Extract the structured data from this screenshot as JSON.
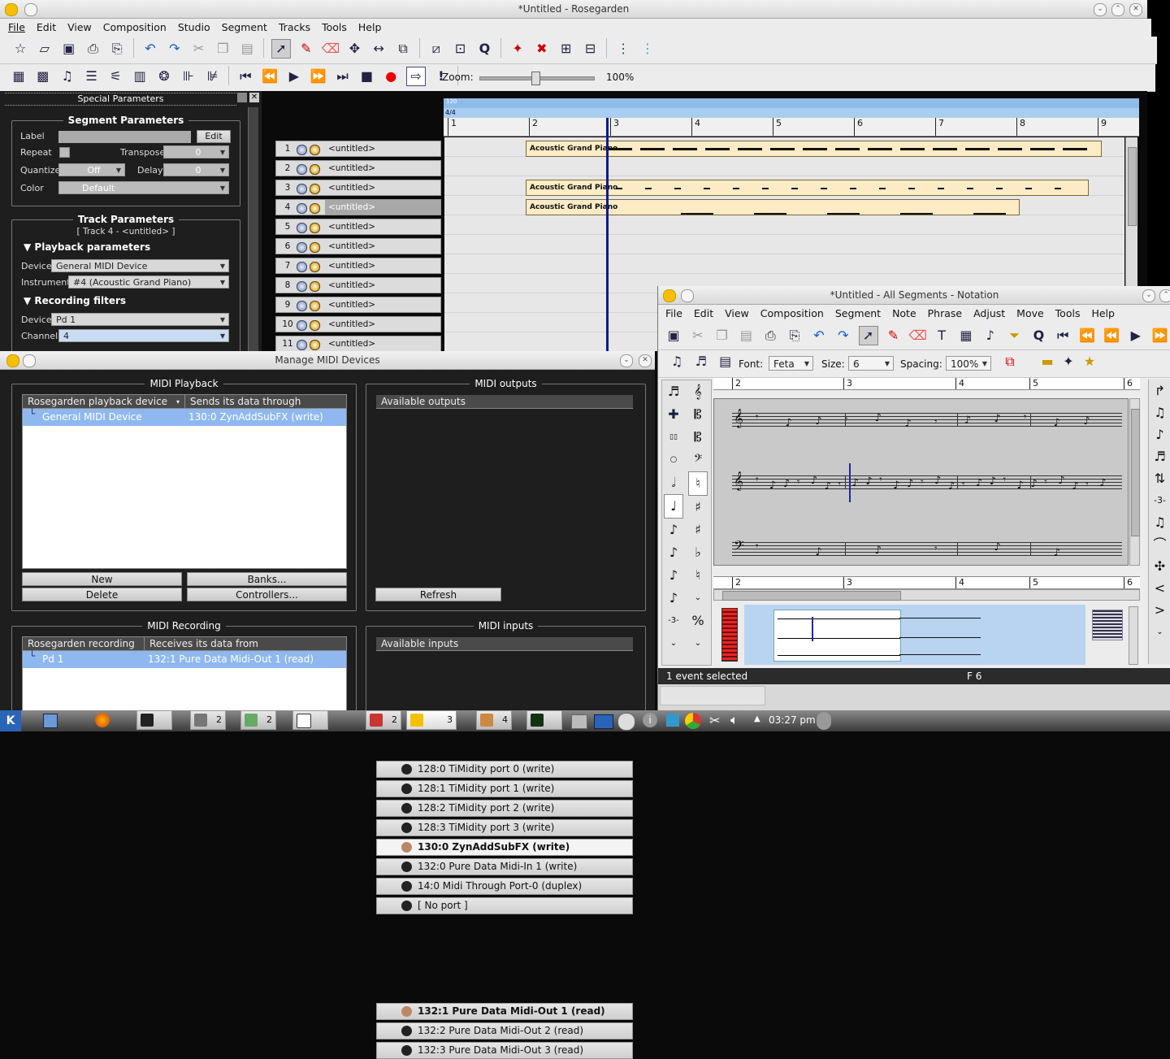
{
  "main": {
    "title": "*Untitled - Rosegarden",
    "menu": [
      "File",
      "Edit",
      "View",
      "Composition",
      "Studio",
      "Segment",
      "Tracks",
      "Tools",
      "Help"
    ],
    "zoom_label": "Zoom:",
    "zoom_value": "100%",
    "zoom_level": 0.48
  },
  "special": {
    "title": "Special Parameters",
    "segment": {
      "title": "Segment Parameters",
      "label": "Label",
      "edit": "Edit",
      "repeat": "Repeat",
      "transpose": "Transpose",
      "transpose_val": "0",
      "quantize": "Quantize",
      "quantize_val": "Off",
      "delay": "Delay",
      "delay_val": "0",
      "color": "Color",
      "color_val": "Default"
    },
    "track": {
      "title": "Track Parameters",
      "subtitle": "[ Track 4 - <untitled> ]",
      "playback": "Playback parameters",
      "device": "Device",
      "device_val": "General MIDI Device",
      "instrument": "Instrument",
      "instrument_val": "#4 (Acoustic Grand Piano)",
      "recording": "Recording filters",
      "rec_device": "Device",
      "rec_device_val": "Pd 1",
      "channel": "Channel",
      "channel_val": "4"
    }
  },
  "ruler": {
    "tempo": "120",
    "timesig": "4/4",
    "bars": [
      "1",
      "2",
      "3",
      "4",
      "5",
      "6",
      "7",
      "8",
      "9"
    ]
  },
  "tracks": [
    {
      "num": "1",
      "name": "<untitled>"
    },
    {
      "num": "2",
      "name": "<untitled>"
    },
    {
      "num": "3",
      "name": "<untitled>"
    },
    {
      "num": "4",
      "name": "<untitled>"
    },
    {
      "num": "5",
      "name": "<untitled>"
    },
    {
      "num": "6",
      "name": "<untitled>"
    },
    {
      "num": "7",
      "name": "<untitled>"
    },
    {
      "num": "8",
      "name": "<untitled>"
    },
    {
      "num": "9",
      "name": "<untitled>"
    },
    {
      "num": "10",
      "name": "<untitled>"
    },
    {
      "num": "11",
      "name": "<untitled>"
    }
  ],
  "segments": [
    "Acoustic Grand Piano",
    "Acoustic Grand Piano",
    "Acoustic Grand Piano"
  ],
  "midi": {
    "title": "Manage MIDI Devices",
    "playback_title": "MIDI Playback",
    "playback_cols": [
      "Rosegarden playback device",
      "Sends its data through"
    ],
    "playback_row": [
      "General MIDI Device",
      "130:0 ZynAddSubFX (write)"
    ],
    "new": "New",
    "banks": "Banks...",
    "delete": "Delete",
    "controllers": "Controllers...",
    "outputs_title": "MIDI outputs",
    "outputs_header": "Available outputs",
    "outputs": [
      "128:0 TiMidity port 0 (write)",
      "128:1 TiMidity port 1 (write)",
      "128:2 TiMidity port 2 (write)",
      "128:3 TiMidity port 3 (write)",
      "130:0 ZynAddSubFX (write)",
      "132:0 Pure Data Midi-In 1 (write)",
      "14:0 Midi Through Port-0 (duplex)",
      "[ No port ]"
    ],
    "refresh": "Refresh",
    "recording_title": "MIDI Recording",
    "recording_cols": [
      "Rosegarden recording d",
      "Receives its data from"
    ],
    "recording_row": [
      "Pd 1",
      "132:1 Pure Data Midi-Out 1 (read)"
    ],
    "inputs_title": "MIDI inputs",
    "inputs_header": "Available inputs",
    "inputs": [
      "132:1 Pure Data Midi-Out 1 (read)",
      "132:2 Pure Data Midi-Out 2 (read)",
      "132:3 Pure Data Midi-Out 3 (read)"
    ]
  },
  "notation": {
    "title": "*Untitled - All Segments - Notation",
    "menu": [
      "File",
      "Edit",
      "View",
      "Composition",
      "Segment",
      "Note",
      "Phrase",
      "Adjust",
      "Move",
      "Tools",
      "Help"
    ],
    "font_label": "Font:",
    "font_val": "Feta",
    "size_label": "Size:",
    "size_val": "6",
    "spacing_label": "Spacing:",
    "spacing_val": "100%",
    "bars": [
      "2",
      "3",
      "4",
      "5",
      "6"
    ],
    "status": "1 event selected",
    "status_key": "F 6"
  },
  "taskbar": {
    "counts": [
      "2",
      "2",
      "2",
      "3",
      "4"
    ],
    "clock": "03:27 pm"
  }
}
